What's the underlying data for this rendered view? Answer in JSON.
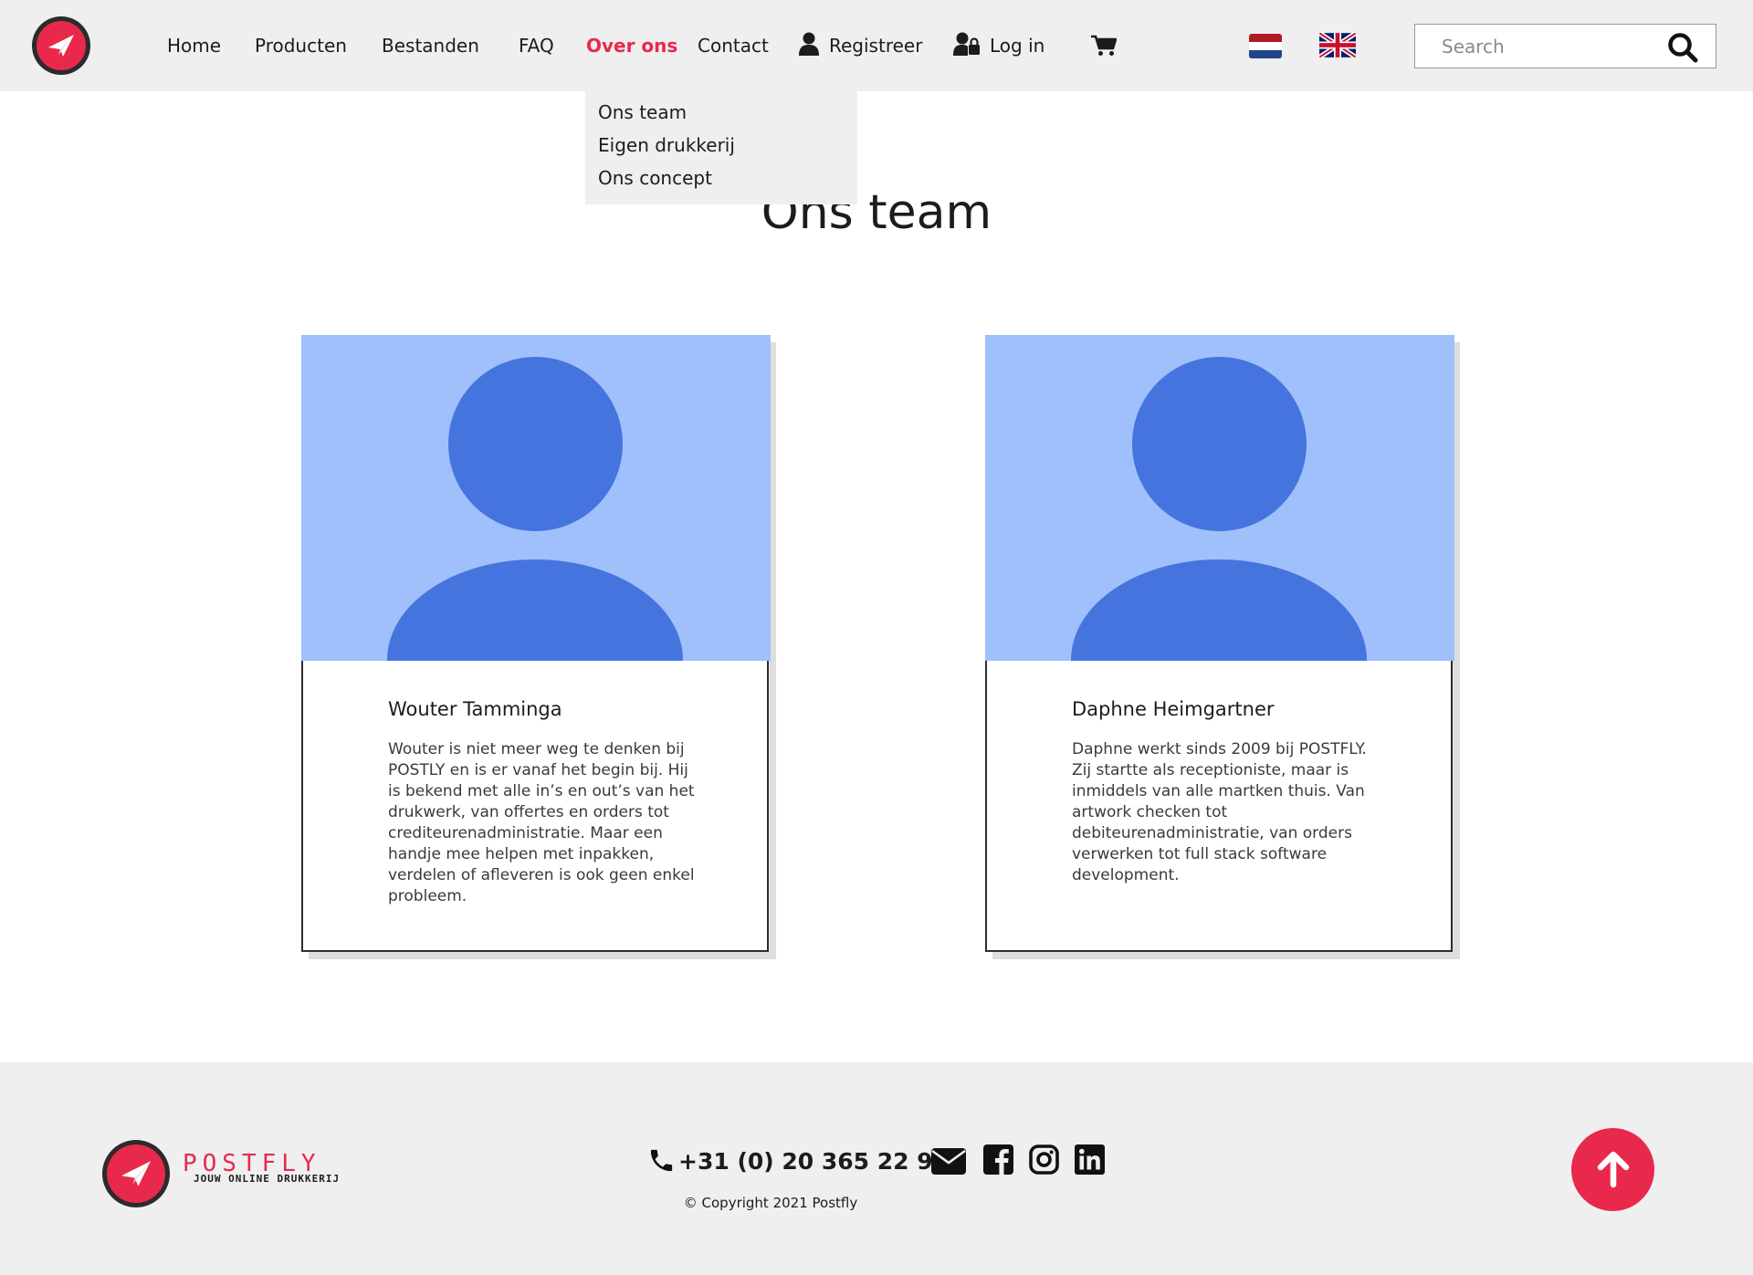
{
  "nav": {
    "logo_icon": "paper-plane-logo-icon",
    "links": [
      {
        "label": "Home"
      },
      {
        "label": "Producten"
      },
      {
        "label": "Bestanden"
      },
      {
        "label": "FAQ"
      },
      {
        "label": "Over ons",
        "active": true
      },
      {
        "label": "Contact"
      }
    ],
    "register_label": "Registreer",
    "register_icon": "user-icon",
    "login_label": "Log in",
    "login_icon": "user-lock-icon",
    "cart_icon": "shopping-cart-icon",
    "languages": [
      {
        "icon": "dutch-flag-icon"
      },
      {
        "icon": "uk-flag-icon"
      }
    ],
    "search": {
      "placeholder": "Search",
      "value": "",
      "icon": "search-icon"
    }
  },
  "dropdown": {
    "items": [
      "Ons team",
      "Eigen drukkerij",
      "Ons concept"
    ]
  },
  "page": {
    "title": "Ons team"
  },
  "team": [
    {
      "name": "Wouter Tamminga",
      "bio": "Wouter is niet meer weg te denken bij POSTLY en is er vanaf het begin bij. Hij is bekend met alle in’s en out’s van het drukwerk, van offertes en orders tot crediteurenadministratie. Maar een handje mee helpen met inpakken, verdelen of afleveren is ook geen enkel probleem.",
      "avatar_icon": "user-placeholder-icon"
    },
    {
      "name": "Daphne Heimgartner",
      "bio": "Daphne werkt sinds 2009 bij POSTFLY. Zij startte als receptioniste, maar is inmiddels van alle martken thuis. Van artwork checken tot debiteurenadministratie, van orders verwerken tot full stack software development.",
      "avatar_icon": "user-placeholder-icon"
    }
  ],
  "footer": {
    "brand": "POSTFLY",
    "tagline": "JOUW ONLINE DRUKKERIJ",
    "phone": "+31 (0) 20 365 22 93",
    "phone_icon": "phone-icon",
    "social_icons": [
      "envelope-icon",
      "facebook-icon",
      "instagram-icon",
      "linkedin-icon"
    ],
    "copyright": "© Copyright 2021 Postfly",
    "back_to_top_icon": "arrow-up-icon"
  },
  "colors": {
    "accent": "#e8294c",
    "nav_bg": "#efefef",
    "avatar_bg": "#9fc0fb",
    "avatar_fg": "#4674df",
    "text": "#1c1c1c"
  }
}
